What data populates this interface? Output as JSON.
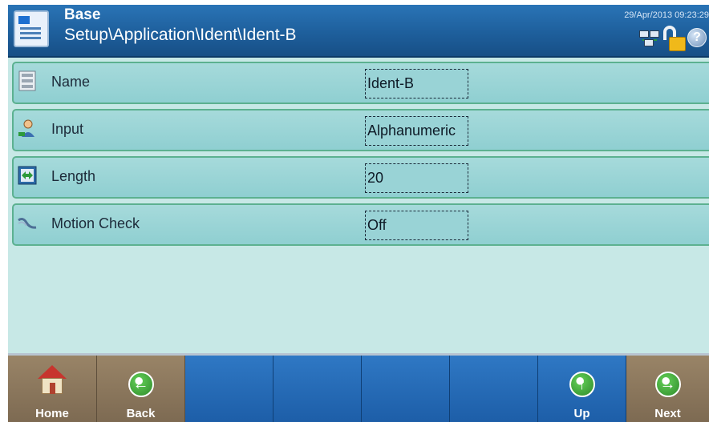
{
  "header": {
    "title": "Base",
    "path": "Setup\\Application\\Ident\\Ident-B",
    "timestamp": "29/Apr/2013 09:23:29",
    "icons": [
      "base-app-icon",
      "network-status-icon",
      "unlocked-icon",
      "help-icon"
    ],
    "help_glyph": "?"
  },
  "rows": [
    {
      "label": "Name",
      "value": "Ident-B",
      "icon": "text-field-icon"
    },
    {
      "label": "Input",
      "value": "Alphanumeric",
      "icon": "operator-input-icon"
    },
    {
      "label": "Length",
      "value": "20",
      "icon": "length-arrows-icon"
    },
    {
      "label": "Motion Check",
      "value": "Off",
      "icon": "motion-check-icon"
    }
  ],
  "footer": {
    "buttons": [
      {
        "label": "Home",
        "icon": "home-icon",
        "color": "#7d6a52"
      },
      {
        "label": "Back",
        "icon": "back-arrow-icon",
        "color": "#7d6a52"
      },
      {
        "label": "",
        "icon": "",
        "color": "#1d5ea8"
      },
      {
        "label": "",
        "icon": "",
        "color": "#1d5ea8"
      },
      {
        "label": "",
        "icon": "",
        "color": "#1d5ea8"
      },
      {
        "label": "",
        "icon": "",
        "color": "#1d5ea8"
      },
      {
        "label": "Up",
        "icon": "up-arrow-icon",
        "color": "#1d5ea8"
      },
      {
        "label": "Next",
        "icon": "next-arrow-icon",
        "color": "#7d6a52"
      }
    ],
    "arrow_glyphs": {
      "back": "←",
      "up": "↑",
      "next": "→"
    }
  },
  "colors": {
    "header_blue": "#1e5f9c",
    "row_teal": "#99d3d6",
    "row_border_green": "#5cb190",
    "footer_blue": "#1d5ea8",
    "footer_brown": "#7d6a52",
    "lock_yellow": "#f0b91a"
  }
}
